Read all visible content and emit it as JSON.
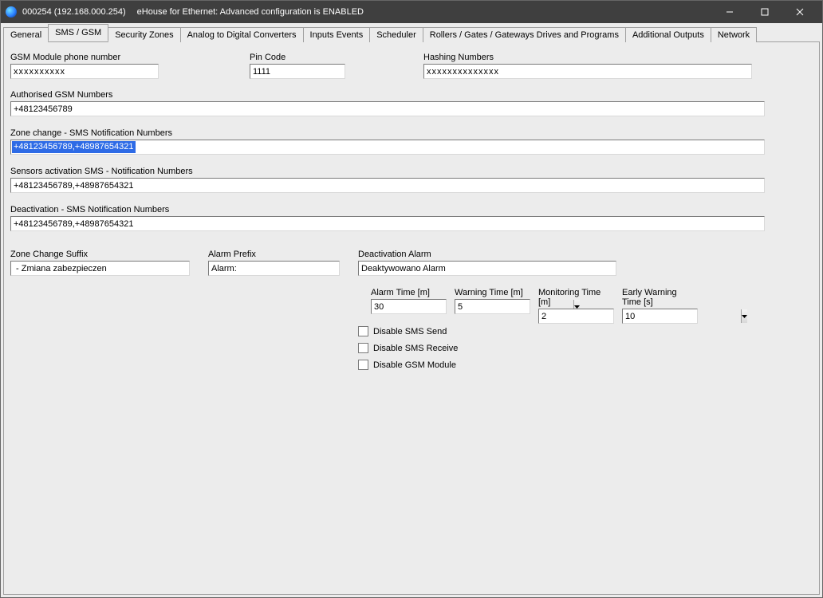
{
  "titlebar": {
    "device": "000254 (192.168.000.254)",
    "subtitle": "eHouse for Ethernet: Advanced configuration is ENABLED"
  },
  "tabs": [
    "General",
    "SMS / GSM",
    "Security Zones",
    "Analog to Digital Converters",
    "Inputs Events",
    "Scheduler",
    "Rollers / Gates / Gateways Drives  and Programs",
    "Additional Outputs",
    "Network"
  ],
  "active_tab_index": 1,
  "fields": {
    "gsm_phone": {
      "label": "GSM Module phone number",
      "value": "xxxxxxxxxx"
    },
    "pin": {
      "label": "Pin Code",
      "value": "1111"
    },
    "hashing": {
      "label": "Hashing Numbers",
      "value": "xxxxxxxxxxxxxx"
    },
    "authorised": {
      "label": "Authorised GSM Numbers",
      "value": "+48123456789"
    },
    "zone_change": {
      "label": "Zone change - SMS Notification Numbers",
      "value": "+48123456789,+48987654321",
      "selected": true
    },
    "sensors": {
      "label": "Sensors activation SMS - Notification Numbers",
      "value": "+48123456789,+48987654321"
    },
    "deact_nums": {
      "label": "Deactivation - SMS Notification Numbers",
      "value": "+48123456789,+48987654321"
    },
    "zcs": {
      "label": "Zone Change Suffix",
      "value": " - Zmiana zabezpieczen"
    },
    "alarm_pref": {
      "label": "Alarm Prefix",
      "value": "Alarm:"
    },
    "deact_alarm": {
      "label": "Deactivation Alarm",
      "value": "Deaktywowano Alarm"
    }
  },
  "times": {
    "alarm": {
      "label": "Alarm Time [m]",
      "value": "30"
    },
    "warning": {
      "label": "Warning Time [m]",
      "value": "5"
    },
    "monitoring": {
      "label": "Monitoring Time [m]",
      "value": "2"
    },
    "early": {
      "label": "Early Warning Time [s]",
      "value": "10"
    }
  },
  "checkboxes": {
    "disable_send": {
      "label": "Disable SMS Send",
      "checked": false
    },
    "disable_receive": {
      "label": "Disable SMS Receive",
      "checked": false
    },
    "disable_module": {
      "label": "Disable GSM Module",
      "checked": false
    }
  }
}
